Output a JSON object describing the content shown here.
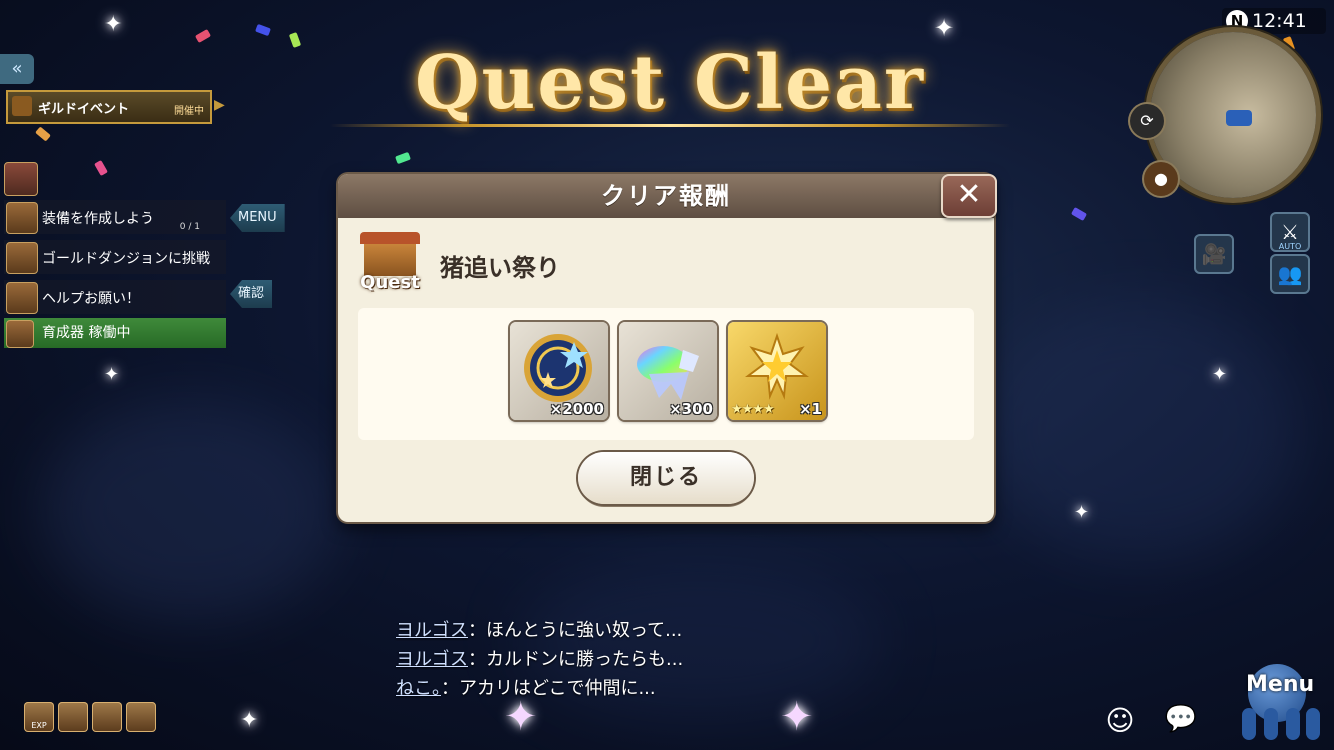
{
  "title": "Quest Clear",
  "sidebar": {
    "collapse_icon": "«",
    "guild_event": {
      "label": "ギルドイベント",
      "status": "開催中"
    },
    "quests": [
      {
        "label": "装備を作成しよう",
        "count": "0 / 1"
      },
      {
        "label": "ゴールドダンジョンに挑戦",
        "count": ""
      },
      {
        "label": "ヘルプお願い！",
        "count": ""
      },
      {
        "label": "育成器 稼働中",
        "count": ""
      }
    ],
    "menu_tag": "MENU",
    "confirm_tag": "確認"
  },
  "dialog": {
    "header": "クリア報酬",
    "close_icon": "✕",
    "quest_badge": "Quest",
    "quest_name": "猪追い祭り",
    "rewards": [
      {
        "icon": "medal-coin-icon",
        "qty": "×2000"
      },
      {
        "icon": "rainbow-crystal-icon",
        "qty": "×300"
      },
      {
        "icon": "star-ticket-icon",
        "stars": "★★★★",
        "qty": "×1"
      }
    ],
    "close_button": "閉じる"
  },
  "hud": {
    "compass": "N",
    "time": "12:41",
    "auto_label": "AUTO"
  },
  "chat": [
    {
      "name": "ヨルゴス",
      "text": "：ほんとうに強い奴って..."
    },
    {
      "name": "ヨルゴス",
      "text": "：カルドンに勝ったらも..."
    },
    {
      "name": "ねこ。",
      "text": "：アカリはどこで仲間に..."
    }
  ],
  "bottom_left": {
    "exp_label": "EXP"
  },
  "menu_label": "Menu"
}
